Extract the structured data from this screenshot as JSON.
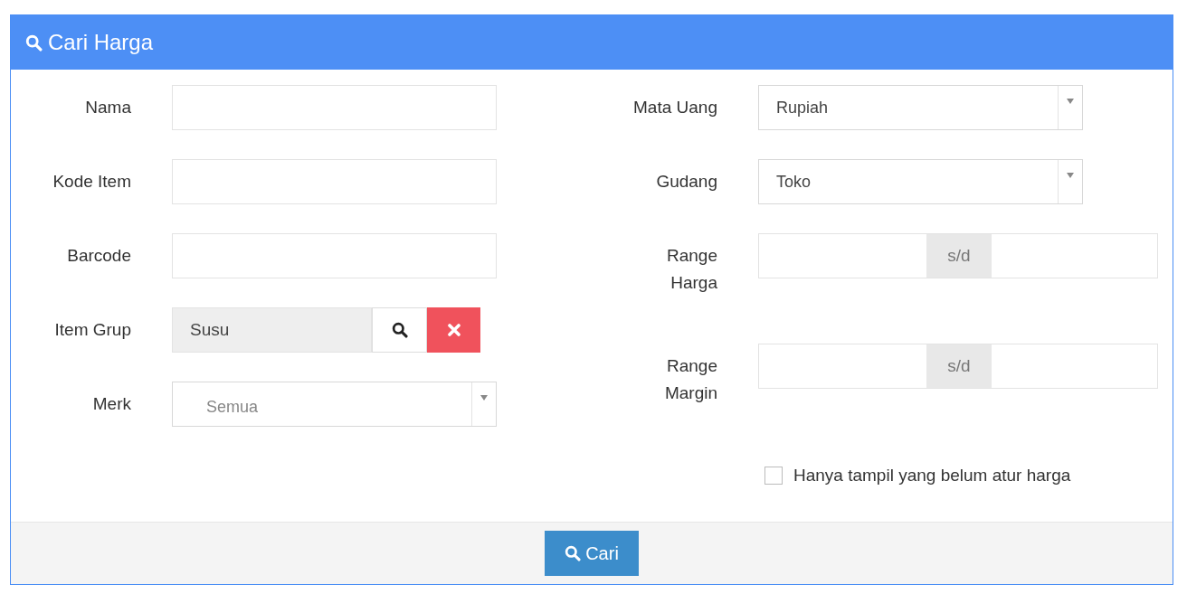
{
  "header": {
    "title": "Cari Harga"
  },
  "left_fields": [
    {
      "label": "Nama",
      "kind": "text"
    },
    {
      "label": "Kode Item",
      "kind": "text"
    },
    {
      "label": "Barcode",
      "kind": "text"
    },
    {
      "label": "Item Grup",
      "kind": "lookup",
      "value": "Susu"
    },
    {
      "label": "Merk",
      "kind": "select",
      "value": "Semua"
    }
  ],
  "right_fields": [
    {
      "label": "Mata Uang",
      "kind": "select",
      "value": "Rupiah"
    },
    {
      "label": "Gudang",
      "kind": "select",
      "value": "Toko"
    },
    {
      "label": "Range Harga",
      "kind": "range",
      "separator": "s/d"
    },
    {
      "label": "Range Margin",
      "kind": "range",
      "separator": "s/d"
    }
  ],
  "checkbox": {
    "label": "Hanya tampil yang belum atur harga",
    "checked": false
  },
  "submit": {
    "label": "Cari"
  }
}
